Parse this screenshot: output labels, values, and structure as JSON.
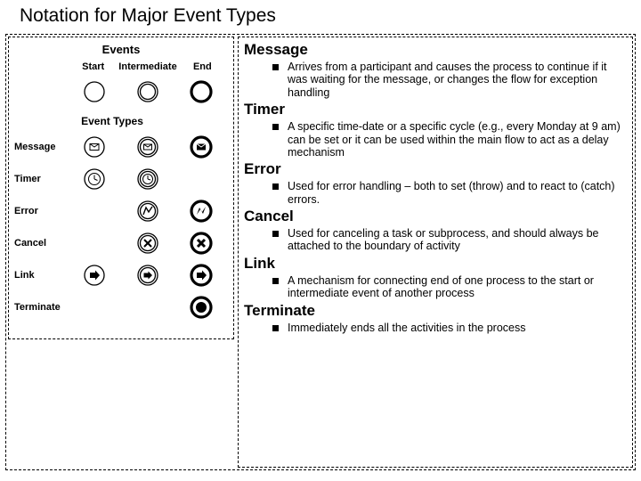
{
  "title": "Notation for Major Event Types",
  "table": {
    "heading": "Events",
    "cols": [
      "Start",
      "Intermediate",
      "End"
    ],
    "subheading": "Event Types",
    "rows": [
      "Message",
      "Timer",
      "Error",
      "Cancel",
      "Link",
      "Terminate"
    ]
  },
  "sections": [
    {
      "h": "Message",
      "d": "Arrives from a participant and causes the process to continue if it was waiting for the message, or changes the flow for exception handling"
    },
    {
      "h": "Timer",
      "d": "A specific time-date or a specific cycle (e.g., every Monday at 9 am) can be set or it can be used within the main flow to act as a delay mechanism"
    },
    {
      "h": "Error",
      "d": "Used for error handling – both to set (throw) and to react to (catch) errors."
    },
    {
      "h": "Cancel",
      "d": "Used for canceling a task or subprocess, and should always be attached to the boundary of activity"
    },
    {
      "h": "Link",
      "d": "A mechanism for connecting end of one process to the start or intermediate event of another process"
    },
    {
      "h": "Terminate",
      "d": "Immediately ends all the activities in the process"
    }
  ]
}
